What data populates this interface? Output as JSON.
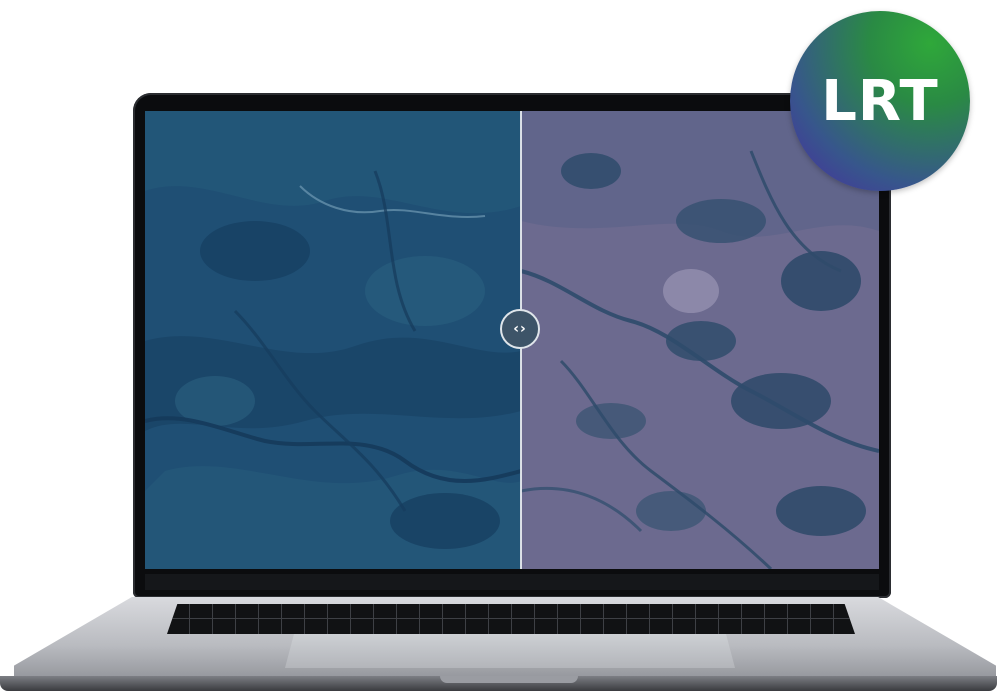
{
  "brand": {
    "logo_text": "LRT",
    "logo_colors": [
      "#2fa83a",
      "#4a2aa0"
    ]
  },
  "comparison": {
    "left_image": "satellite-view-before",
    "right_image": "satellite-view-after",
    "slider_position": 0.51,
    "handle_glyph": "‹›",
    "handle_icon": "chevron-left-right-icon",
    "colors": {
      "left_tint": "#1d4a6e",
      "right_tint": "#6c6c8e"
    }
  }
}
